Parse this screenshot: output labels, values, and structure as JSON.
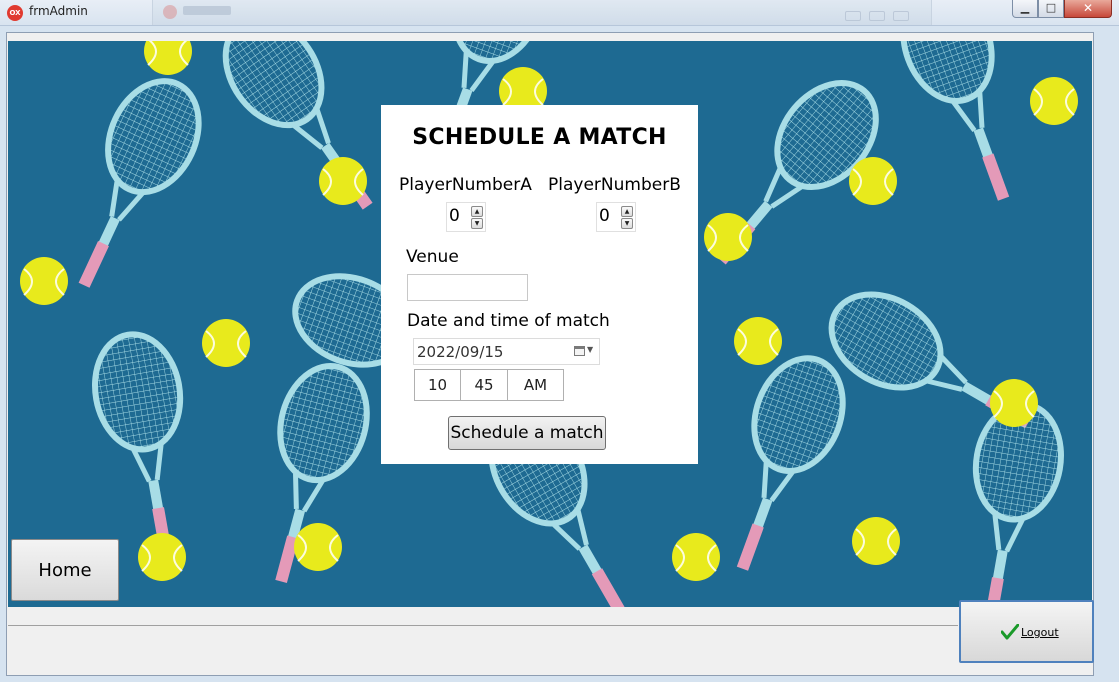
{
  "window": {
    "title": "frmAdmin",
    "app_icon_text": "OX",
    "minimize_glyph": "▁",
    "maximize_glyph": "□",
    "close_glyph": "✕"
  },
  "form": {
    "heading": "SCHEDULE A MATCH",
    "player_a_label": "PlayerNumberA",
    "player_a_value": "0",
    "player_b_label": "PlayerNumberB",
    "player_b_value": "0",
    "venue_label": "Venue",
    "venue_value": "",
    "date_label": "Date and time of match",
    "date_value": "2022/09/15",
    "time_hour": "10",
    "time_minute": "45",
    "time_ampm": "AM",
    "submit_label": "Schedule a match"
  },
  "nav": {
    "home_label": "Home",
    "logout_label": "Logout"
  },
  "colors": {
    "background_pattern": "#1e6a92",
    "racket_frame": "#a8dde6",
    "racket_grip": "#e49ab8",
    "ball": "#e8ea1c",
    "logout_border": "#4f81bd",
    "check": "#1a9a2a"
  },
  "icons": {
    "app": "app-icon",
    "spin_up": "arrow-up-icon",
    "spin_down": "arrow-down-icon",
    "calendar": "calendar-icon",
    "logout": "check-icon"
  }
}
